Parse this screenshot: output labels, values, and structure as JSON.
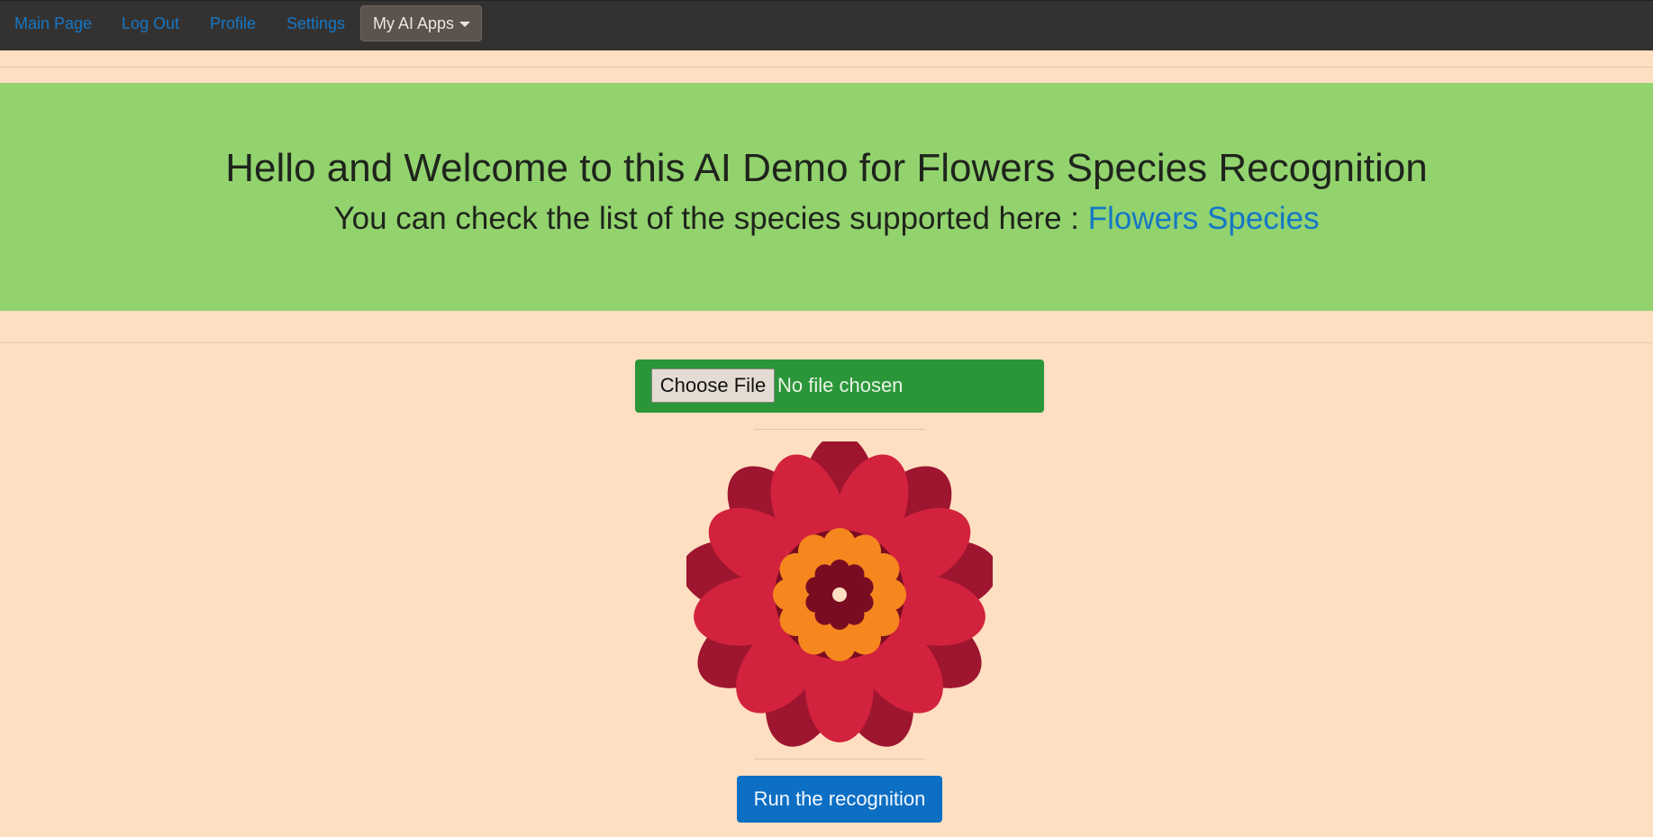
{
  "navbar": {
    "links": [
      "Main Page",
      "Log Out",
      "Profile",
      "Settings"
    ],
    "dropdown_label": "My AI Apps"
  },
  "hero": {
    "title": "Hello and Welcome to this AI Demo for Flowers Species Recognition",
    "subtitle_text": "You can check the list of the species supported here : ",
    "subtitle_link": "Flowers Species"
  },
  "upload": {
    "button_label": "Choose File",
    "status": "No file chosen"
  },
  "image": {
    "icon": "flower-icon"
  },
  "actions": {
    "run_label": "Run the recognition"
  },
  "colors": {
    "page_bg": "#ffdfc1",
    "navbar_bg": "#343231",
    "link": "#1577c6",
    "hero_bg": "#92d36e",
    "upload_bg": "#2a9639",
    "run_bg": "#0c6fc4",
    "petal_outer": "#9e1530",
    "petal_inner": "#d2223d",
    "flower_orange": "#f5871e",
    "flower_center": "#7a0c22"
  }
}
